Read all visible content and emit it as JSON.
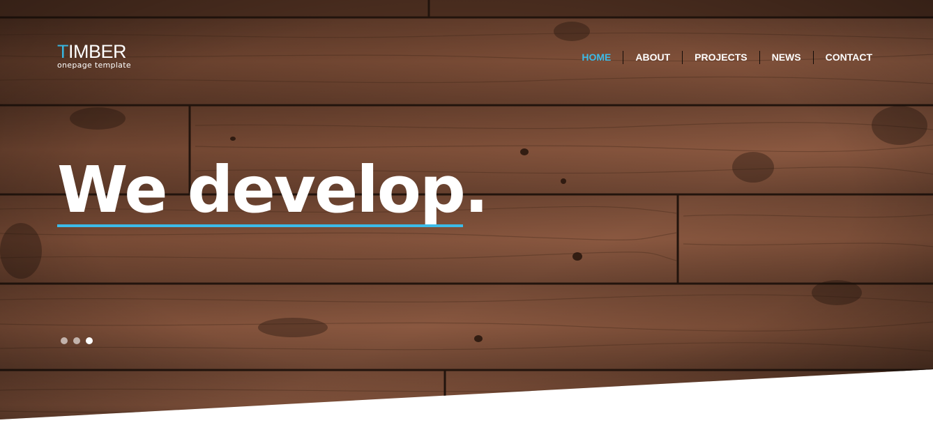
{
  "logo": {
    "first_letter": "T",
    "rest": "IMBER",
    "tagline": "onepage template"
  },
  "nav": {
    "items": [
      {
        "label": "HOME",
        "active": true
      },
      {
        "label": "ABOUT",
        "active": false
      },
      {
        "label": "PROJECTS",
        "active": false
      },
      {
        "label": "NEWS",
        "active": false
      },
      {
        "label": "CONTACT",
        "active": false
      }
    ]
  },
  "hero": {
    "headline": "We develop.",
    "slider": {
      "slide_count": 3,
      "active_slide": 3
    }
  },
  "colors": {
    "accent": "#3cbbe8",
    "wood_base": "#6e4530",
    "wood_dark": "#2b1a12",
    "text": "#ffffff"
  }
}
